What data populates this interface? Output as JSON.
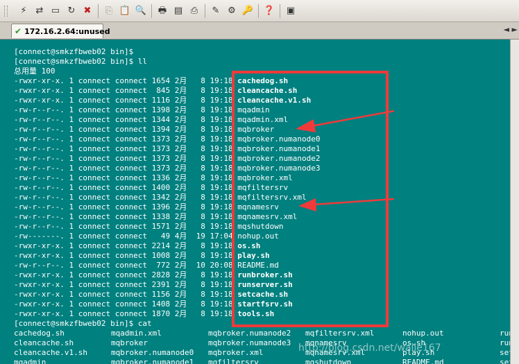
{
  "toolbar": {
    "icons": [
      "connect-icon",
      "quick-connect-icon",
      "connect-tab-icon",
      "reconnect-icon",
      "disconnect-icon",
      "copy-icon",
      "paste-icon",
      "find-icon",
      "print-icon",
      "print-setup-icon",
      "print-screen-icon",
      "session-options-icon",
      "global-options-icon",
      "keymap-icon",
      "help-icon",
      "screenshot-icon"
    ]
  },
  "tab": {
    "label": "172.16.2.64:unused"
  },
  "terminal": {
    "prompt1": "[connect@smkzfbweb02 bin]$",
    "prompt2": "[connect@smkzfbweb02 bin]$ ll",
    "total": "总用量 100",
    "listing": [
      {
        "meta": "-rwxr-xr-x. 1 connect connect 1654 2月   8 19:18 ",
        "name": "cachedog.sh",
        "bold": true
      },
      {
        "meta": "-rwxr-xr-x. 1 connect connect  845 2月   8 19:18 ",
        "name": "cleancache.sh",
        "bold": true
      },
      {
        "meta": "-rwxr-xr-x. 1 connect connect 1116 2月   8 19:18 ",
        "name": "cleancache.v1.sh",
        "bold": true
      },
      {
        "meta": "-rw-r--r--. 1 connect connect 1398 2月   8 19:18 ",
        "name": "mqadmin",
        "bold": false
      },
      {
        "meta": "-rw-r--r--. 1 connect connect 1344 2月   8 19:18 ",
        "name": "mqadmin.xml",
        "bold": false
      },
      {
        "meta": "-rw-r--r--. 1 connect connect 1394 2月   8 19:18 ",
        "name": "mqbroker",
        "bold": false
      },
      {
        "meta": "-rw-r--r--. 1 connect connect 1373 2月   8 19:18 ",
        "name": "mqbroker.numanode0",
        "bold": false
      },
      {
        "meta": "-rw-r--r--. 1 connect connect 1373 2月   8 19:18 ",
        "name": "mqbroker.numanode1",
        "bold": false
      },
      {
        "meta": "-rw-r--r--. 1 connect connect 1373 2月   8 19:18 ",
        "name": "mqbroker.numanode2",
        "bold": false
      },
      {
        "meta": "-rw-r--r--. 1 connect connect 1373 2月   8 19:18 ",
        "name": "mqbroker.numanode3",
        "bold": false
      },
      {
        "meta": "-rw-r--r--. 1 connect connect 1336 2月   8 19:18 ",
        "name": "mqbroker.xml",
        "bold": false
      },
      {
        "meta": "-rw-r--r--. 1 connect connect 1400 2月   8 19:18 ",
        "name": "mqfiltersrv",
        "bold": false
      },
      {
        "meta": "-rw-r--r--. 1 connect connect 1342 2月   8 19:18 ",
        "name": "mqfiltersrv.xml",
        "bold": false
      },
      {
        "meta": "-rw-r--r--. 1 connect connect 1396 2月   8 19:18 ",
        "name": "mqnamesrv",
        "bold": false
      },
      {
        "meta": "-rw-r--r--. 1 connect connect 1338 2月   8 19:18 ",
        "name": "mqnamesrv.xml",
        "bold": false
      },
      {
        "meta": "-rw-r--r--. 1 connect connect 1571 2月   8 19:18 ",
        "name": "mqshutdown",
        "bold": false
      },
      {
        "meta": "-rw-------. 1 connect connect   49 4月  19 17:04 ",
        "name": "nohup.out",
        "bold": false
      },
      {
        "meta": "-rwxr-xr-x. 1 connect connect 2214 2月   8 19:18 ",
        "name": "os.sh",
        "bold": true
      },
      {
        "meta": "-rwxr-xr-x. 1 connect connect 1008 2月   8 19:18 ",
        "name": "play.sh",
        "bold": true
      },
      {
        "meta": "-rw-r--r--. 1 connect connect  772 2月  10 20:08 ",
        "name": "README.md",
        "bold": false
      },
      {
        "meta": "-rwxr-xr-x. 1 connect connect 2828 2月   8 19:18 ",
        "name": "runbroker.sh",
        "bold": true
      },
      {
        "meta": "-rwxr-xr-x. 1 connect connect 2391 2月   8 19:18 ",
        "name": "runserver.sh",
        "bold": true
      },
      {
        "meta": "-rwxr-xr-x. 1 connect connect 1156 2月   8 19:18 ",
        "name": "setcache.sh",
        "bold": true
      },
      {
        "meta": "-rwxr-xr-x. 1 connect connect 1408 2月   8 19:18 ",
        "name": "startfsrv.sh",
        "bold": true
      },
      {
        "meta": "-rwxr-xr-x. 1 connect connect 1870 2月   8 19:18 ",
        "name": "tools.sh",
        "bold": true
      }
    ],
    "prompt3": "[connect@smkzfbweb02 bin]$ cat",
    "grid": [
      [
        "cachedog.sh",
        "mqadmin.xml",
        "mqbroker.numanode2",
        "mqfiltersrv.xml",
        "nohup.out",
        "runb"
      ],
      [
        "cleancache.sh",
        "mqbroker",
        "mqbroker.numanode3",
        "mqnamesrv",
        "os.sh",
        "runs"
      ],
      [
        "cleancache.v1.sh",
        "mqbroker.numanode0",
        "mqbroker.xml",
        "mqnamesrv.xml",
        "play.sh",
        "setc"
      ],
      [
        "mqadmin",
        "mqbroker.numanode1",
        "mqfiltersrv",
        "mqshutdown",
        "README.md",
        "setc"
      ]
    ]
  },
  "watermark": "http://blog.csdn.net/walle167",
  "colors": {
    "terminal_bg": "#00807f",
    "highlight": "#f03a3a"
  }
}
